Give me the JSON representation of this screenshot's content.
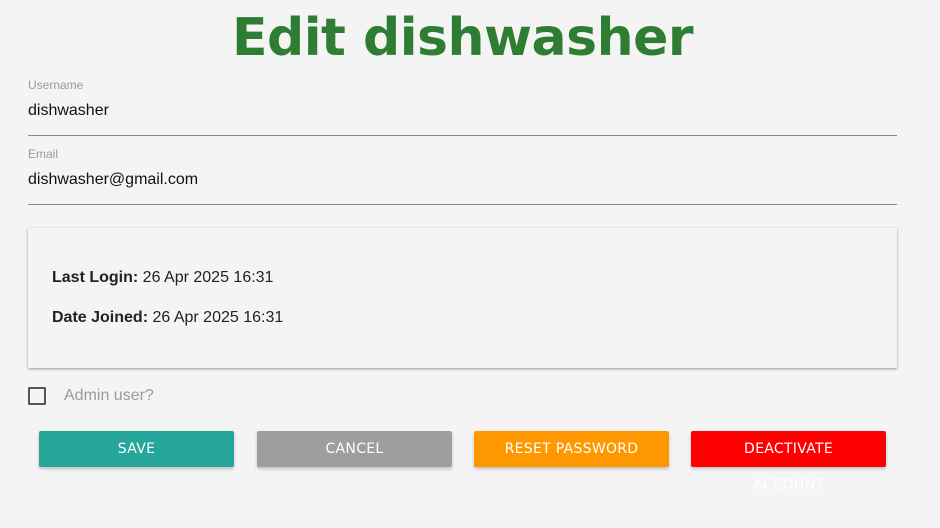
{
  "page": {
    "title": "Edit dishwasher"
  },
  "form": {
    "username": {
      "label": "Username",
      "value": "dishwasher"
    },
    "email": {
      "label": "Email",
      "value": "dishwasher@gmail.com"
    }
  },
  "info": {
    "last_login_label": "Last Login:",
    "last_login_value": "26 Apr 2025 16:31",
    "date_joined_label": "Date Joined:",
    "date_joined_value": "26 Apr 2025 16:31"
  },
  "admin": {
    "label": "Admin user?",
    "checked": false
  },
  "buttons": {
    "save": "SAVE",
    "cancel": "CANCEL",
    "reset_password": "RESET PASSWORD",
    "deactivate_line1": "DEACTIVATE",
    "deactivate_line2": "ACCOUNT"
  },
  "colors": {
    "title": "#2e7d32",
    "save": "#26a69a",
    "cancel": "#9e9e9e",
    "reset_password": "#ff9800",
    "deactivate": "#ff0000"
  }
}
